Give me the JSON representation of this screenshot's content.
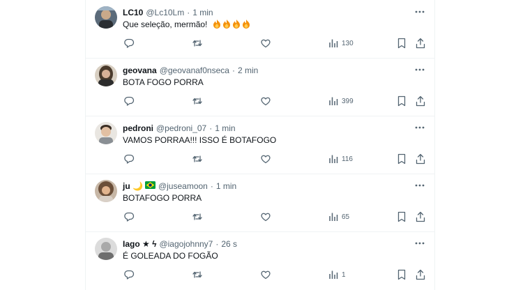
{
  "tweets": [
    {
      "name": "LC10",
      "handle": "@Lc10Lm",
      "separator": "·",
      "time": "1 min",
      "text": "Que seleção, mermão!",
      "emoji": [
        "fire",
        "fire",
        "fire",
        "fire"
      ],
      "views": "130"
    },
    {
      "name": "geovana",
      "handle": "@geovanaf0nseca",
      "separator": "·",
      "time": "2 min",
      "text": "BOTA FOGO PORRA",
      "views": "399"
    },
    {
      "name": "pedroni",
      "handle": "@pedroni_07",
      "separator": "·",
      "time": "1 min",
      "text": "VAMOS PORRAA!!! ISSO É BOTAFOGO",
      "views": "116"
    },
    {
      "name": "ju 🌙",
      "name_emoji": "brazil-flag",
      "handle": "@juseamoon",
      "separator": "·",
      "time": "1 min",
      "text": "BOTAFOGO PORRA",
      "views": "65"
    },
    {
      "name": "Iago ★ ϟ",
      "handle": "@iagojohnny7",
      "separator": "·",
      "time": "26 s",
      "text": "É GOLEADA DO FOGÃO",
      "views": "1"
    }
  ],
  "colors": {
    "text": "#0f1419",
    "muted": "#536471",
    "divider": "#eff3f4"
  },
  "icons": [
    "reply-icon",
    "retweet-icon",
    "like-icon",
    "views-icon",
    "bookmark-icon",
    "share-icon",
    "more-icon"
  ]
}
